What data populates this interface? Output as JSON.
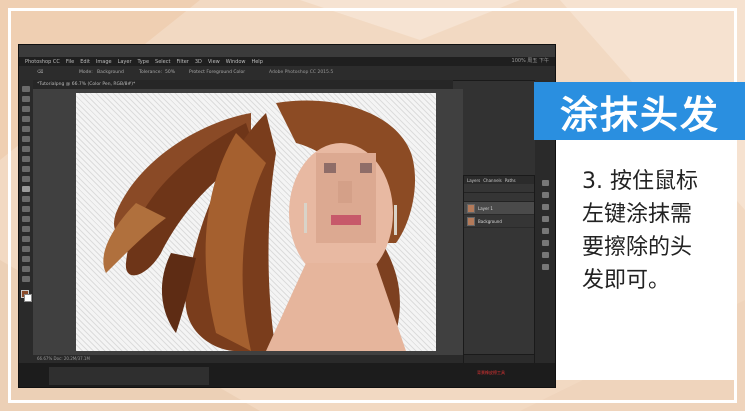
{
  "slide": {
    "title": "涂抹头发",
    "step_lines": [
      "3. 按住鼠标",
      "左键涂抹需",
      "要擦除的头",
      "发即可。"
    ],
    "accent_color": "#2a8fe0"
  },
  "photoshop": {
    "mac_menu": [
      "Photoshop CC",
      "File",
      "Edit",
      "Image",
      "Layer",
      "Type",
      "Select",
      "Filter",
      "3D",
      "View",
      "Window",
      "Help"
    ],
    "app_title": "Adobe Photoshop CC 2015.5",
    "status_right": "100% 周五 下午",
    "options": {
      "mode_label": "Mode:",
      "mode_value": "Background",
      "tolerance_label": "Tolerance:",
      "tolerance_value": "50%",
      "protect_label": "Protect Foreground Color"
    },
    "doc_tab": "*Tutorialpng @ 66.7% (Color Pen, RGB/8#)*",
    "status_bar": "66.67%     Doc: 20.2M/37.1M",
    "layers_panel": {
      "tabs": [
        "Layers",
        "Channels",
        "Paths"
      ],
      "rows": [
        {
          "name": "Layer 1",
          "active": true
        },
        {
          "name": "Background",
          "active": false
        }
      ]
    },
    "bottom_red_label": "背景橡皮擦工具"
  }
}
